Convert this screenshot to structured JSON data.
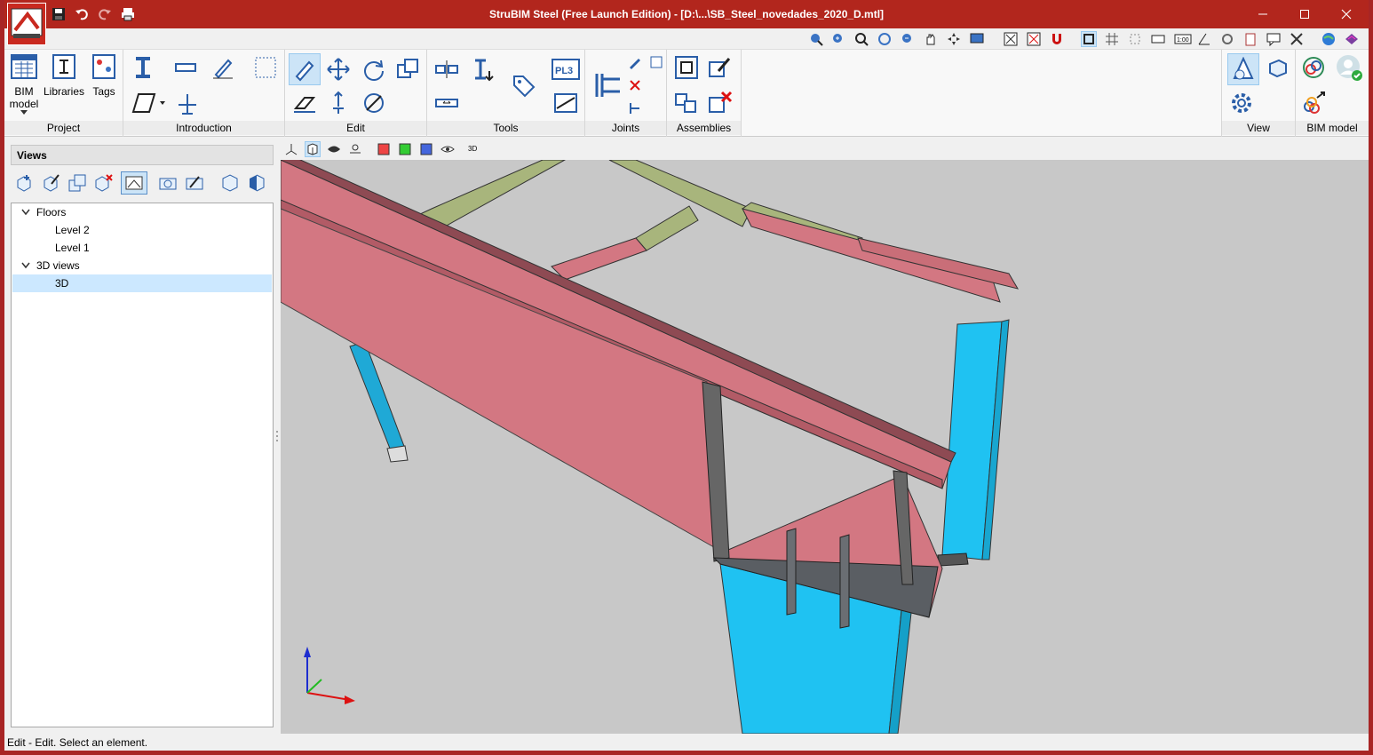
{
  "window": {
    "title": "StruBIM Steel (Free Launch Edition) - [D:\\...\\SB_Steel_novedades_2020_D.mtl]",
    "controls": [
      "minimize-icon",
      "maximize-icon",
      "close-icon"
    ]
  },
  "quick_access": [
    "save-icon",
    "undo-icon",
    "redo-icon",
    "print-icon"
  ],
  "ribbon": {
    "groups": {
      "project": "Project",
      "introduction": "Introduction",
      "edit": "Edit",
      "tools": "Tools",
      "joints": "Joints",
      "assemblies": "Assemblies",
      "view": "View",
      "bim_model": "BIM model"
    },
    "buttons": {
      "bim_model_line1": "BIM",
      "bim_model_line2": "model",
      "libraries": "Libraries",
      "tags": "Tags",
      "pl3": "PL3"
    }
  },
  "views_panel": {
    "header": "Views",
    "tree": {
      "floors": {
        "label": "Floors",
        "items": [
          "Level 2",
          "Level 1"
        ]
      },
      "views3d": {
        "label": "3D views",
        "items": [
          "3D"
        ]
      }
    }
  },
  "viewport_toolbar": {
    "label_3d": "3D"
  },
  "status_bar": {
    "text": "Edit - Edit. Select an element."
  },
  "colors": {
    "title_bar": "#b2261d",
    "beam": "#d37782",
    "column": "#1fc2f2",
    "secondary_beam": "#a8b57c",
    "background3d": "#c8c8c8",
    "selection": "#cce8ff"
  }
}
